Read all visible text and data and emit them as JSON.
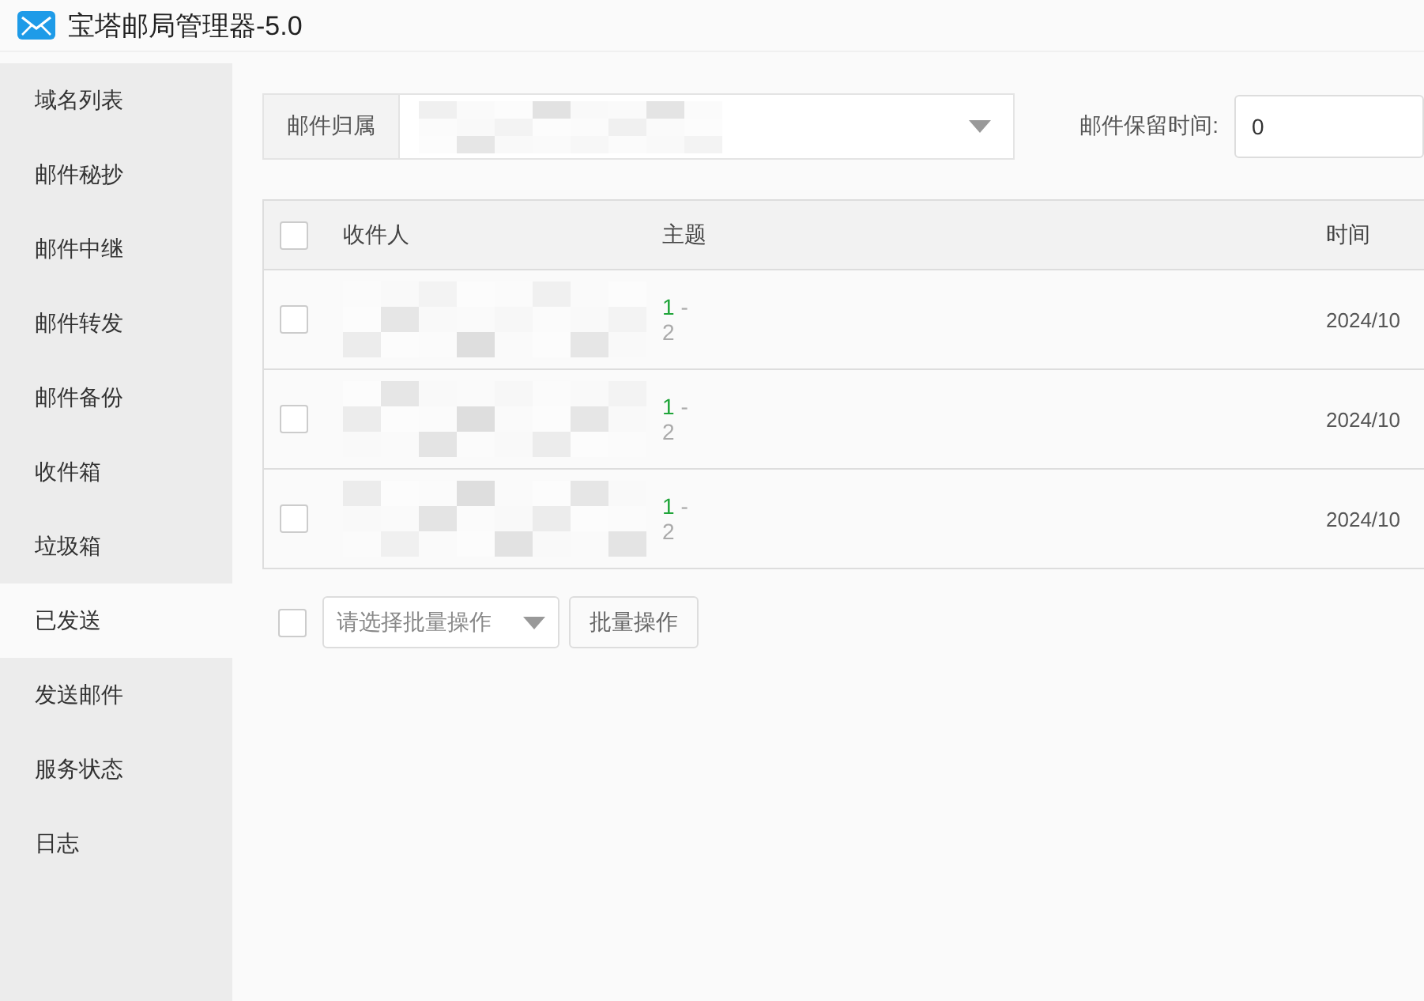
{
  "window": {
    "title": "宝塔邮局管理器-5.0"
  },
  "sidebar": {
    "items": [
      {
        "label": "域名列表",
        "selected": false
      },
      {
        "label": "邮件秘抄",
        "selected": false
      },
      {
        "label": "邮件中继",
        "selected": false
      },
      {
        "label": "邮件转发",
        "selected": false
      },
      {
        "label": "邮件备份",
        "selected": false
      },
      {
        "label": "收件箱",
        "selected": false
      },
      {
        "label": "垃圾箱",
        "selected": false
      },
      {
        "label": "已发送",
        "selected": true
      },
      {
        "label": "发送邮件",
        "selected": false
      },
      {
        "label": "服务状态",
        "selected": false
      },
      {
        "label": "日志",
        "selected": false
      }
    ]
  },
  "filter": {
    "owner_label": "邮件归属",
    "retention_label": "邮件保留时间:",
    "retention_value": "0"
  },
  "table": {
    "all_checked": false,
    "columns": [
      "收件人",
      "主题",
      "时间"
    ],
    "rows": [
      {
        "checked": false,
        "subject_main": "1",
        "subject_sep": "-",
        "subject_sub": "2",
        "time": "2024/10"
      },
      {
        "checked": false,
        "subject_main": "1",
        "subject_sep": "-",
        "subject_sub": "2",
        "time": "2024/10"
      },
      {
        "checked": false,
        "subject_main": "1",
        "subject_sep": "-",
        "subject_sub": "2",
        "time": "2024/10"
      }
    ]
  },
  "batch": {
    "checked": false,
    "placeholder": "请选择批量操作",
    "button": "批量操作"
  }
}
